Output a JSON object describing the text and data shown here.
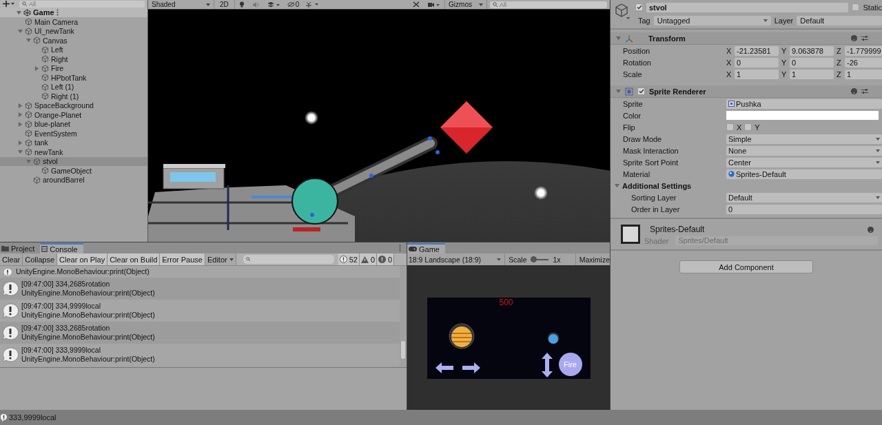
{
  "hierarchy": {
    "search": {
      "placeholder": "All"
    },
    "scene": {
      "name": "Game",
      "expanded": true,
      "items": [
        {
          "name": "Main Camera",
          "selected": false
        },
        {
          "name": "UI_newTank",
          "expanded": true,
          "selected": false,
          "children": [
            {
              "name": "Canvas",
              "expanded": true,
              "selected": false,
              "children": [
                {
                  "name": "Left",
                  "selected": false
                },
                {
                  "name": "Right",
                  "selected": false
                },
                {
                  "name": "Fire",
                  "expanded": false,
                  "selected": false
                },
                {
                  "name": "HPbotTank",
                  "selected": false
                },
                {
                  "name": "Left (1)",
                  "selected": false
                },
                {
                  "name": "Right (1)",
                  "selected": false
                }
              ]
            }
          ]
        },
        {
          "name": "SpaceBackground",
          "expanded": false,
          "selected": false
        },
        {
          "name": "Orange-Planet",
          "expanded": false,
          "selected": false
        },
        {
          "name": "blue-planet",
          "expanded": false,
          "selected": false
        },
        {
          "name": "EventSystem",
          "selected": false
        },
        {
          "name": "tank",
          "expanded": false,
          "selected": false
        },
        {
          "name": "newTank",
          "expanded": true,
          "selected": false,
          "children": [
            {
              "name": "stvol",
              "expanded": true,
              "selected": true,
              "children": [
                {
                  "name": "GameObject",
                  "selected": false
                }
              ]
            },
            {
              "name": "aroundBarrel",
              "selected": false
            }
          ]
        }
      ]
    }
  },
  "scene_toolbar": {
    "draw_mode": "Shaded",
    "mode_2d": "2D",
    "hidden_count": "0",
    "gizmos": "Gizmos",
    "search": {
      "placeholder": "All"
    }
  },
  "inspector": {
    "object": {
      "active": true,
      "name": "stvol",
      "static_label": "Static",
      "static": false,
      "tag_label": "Tag",
      "tag": "Untagged",
      "layer_label": "Layer",
      "layer": "Default"
    },
    "transform": {
      "title": "Transform",
      "expanded": true,
      "rows": [
        {
          "label": "Position",
          "fields": [
            {
              "axis": "X",
              "value": "-21.23581"
            },
            {
              "axis": "Y",
              "value": "9.063878"
            },
            {
              "axis": "Z",
              "value": "-1.779999"
            }
          ]
        },
        {
          "label": "Rotation",
          "fields": [
            {
              "axis": "X",
              "value": "0"
            },
            {
              "axis": "Y",
              "value": "0"
            },
            {
              "axis": "Z",
              "value": "-26"
            }
          ]
        },
        {
          "label": "Scale",
          "fields": [
            {
              "axis": "X",
              "value": "1"
            },
            {
              "axis": "Y",
              "value": "1"
            },
            {
              "axis": "Z",
              "value": "1"
            }
          ]
        }
      ]
    },
    "sprite_renderer": {
      "title": "Sprite Renderer",
      "expanded": true,
      "enabled": true,
      "properties": [
        {
          "kind": "sprite_ref",
          "label": "Sprite",
          "value": "Pushka"
        },
        {
          "kind": "color",
          "label": "Color",
          "color": "#ffffff"
        },
        {
          "kind": "flip",
          "label": "Flip",
          "options": [
            {
              "label": "X",
              "checked": false
            },
            {
              "label": "Y",
              "checked": false
            }
          ]
        },
        {
          "kind": "dropdown",
          "label": "Draw Mode",
          "value": "Simple"
        },
        {
          "kind": "dropdown",
          "label": "Mask Interaction",
          "value": "None"
        },
        {
          "kind": "dropdown",
          "label": "Sprite Sort Point",
          "value": "Center"
        },
        {
          "kind": "material_ref",
          "label": "Material",
          "value": "Sprites-Default"
        },
        {
          "kind": "foldout",
          "label": "Additional Settings",
          "expanded": true,
          "children": [
            {
              "kind": "dropdown",
              "label": "Sorting Layer",
              "value": "Default"
            },
            {
              "kind": "number",
              "label": "Order in Layer",
              "value": "0"
            }
          ]
        }
      ]
    },
    "material": {
      "name": "Sprites-Default",
      "shader_label": "Shader",
      "shader": "Sprites/Default"
    },
    "add_component": "Add Component"
  },
  "console": {
    "tabs": [
      {
        "label": "Project",
        "selected": false
      },
      {
        "label": "Console",
        "selected": true
      }
    ],
    "buttons": [
      {
        "label": "Clear",
        "on": false
      },
      {
        "label": "Collapse",
        "on": false
      },
      {
        "label": "Clear on Play",
        "on": true
      },
      {
        "label": "Clear on Build",
        "on": true
      },
      {
        "label": "Error Pause",
        "on": true
      }
    ],
    "editor": "Editor",
    "counts": {
      "info": "52",
      "warning": "0",
      "error": "0"
    },
    "entries": [
      {
        "lines": [
          "UnityEngine.MonoBehaviour:print(Object)"
        ]
      },
      {
        "lines": [
          "[09:47:00] 334,2685rotation",
          "UnityEngine.MonoBehaviour:print(Object)"
        ]
      },
      {
        "lines": [
          "[09:47:00] 334,9999local",
          "UnityEngine.MonoBehaviour:print(Object)"
        ]
      },
      {
        "lines": [
          "[09:47:00] 333,2685rotation",
          "UnityEngine.MonoBehaviour:print(Object)"
        ]
      },
      {
        "lines": [
          "[09:47:00] 333,9999local",
          "UnityEngine.MonoBehaviour:print(Object)"
        ]
      }
    ]
  },
  "game": {
    "tab": {
      "label": "Game",
      "selected": true
    },
    "aspect": "18:9 Landscape (18:9)",
    "scale_label": "Scale",
    "scale": {
      "level": 0
    },
    "scale_value": "1x",
    "maximize": "Maximize",
    "score": "500",
    "fire": "Fire"
  },
  "status_bar": {
    "message": "333,9999local"
  }
}
